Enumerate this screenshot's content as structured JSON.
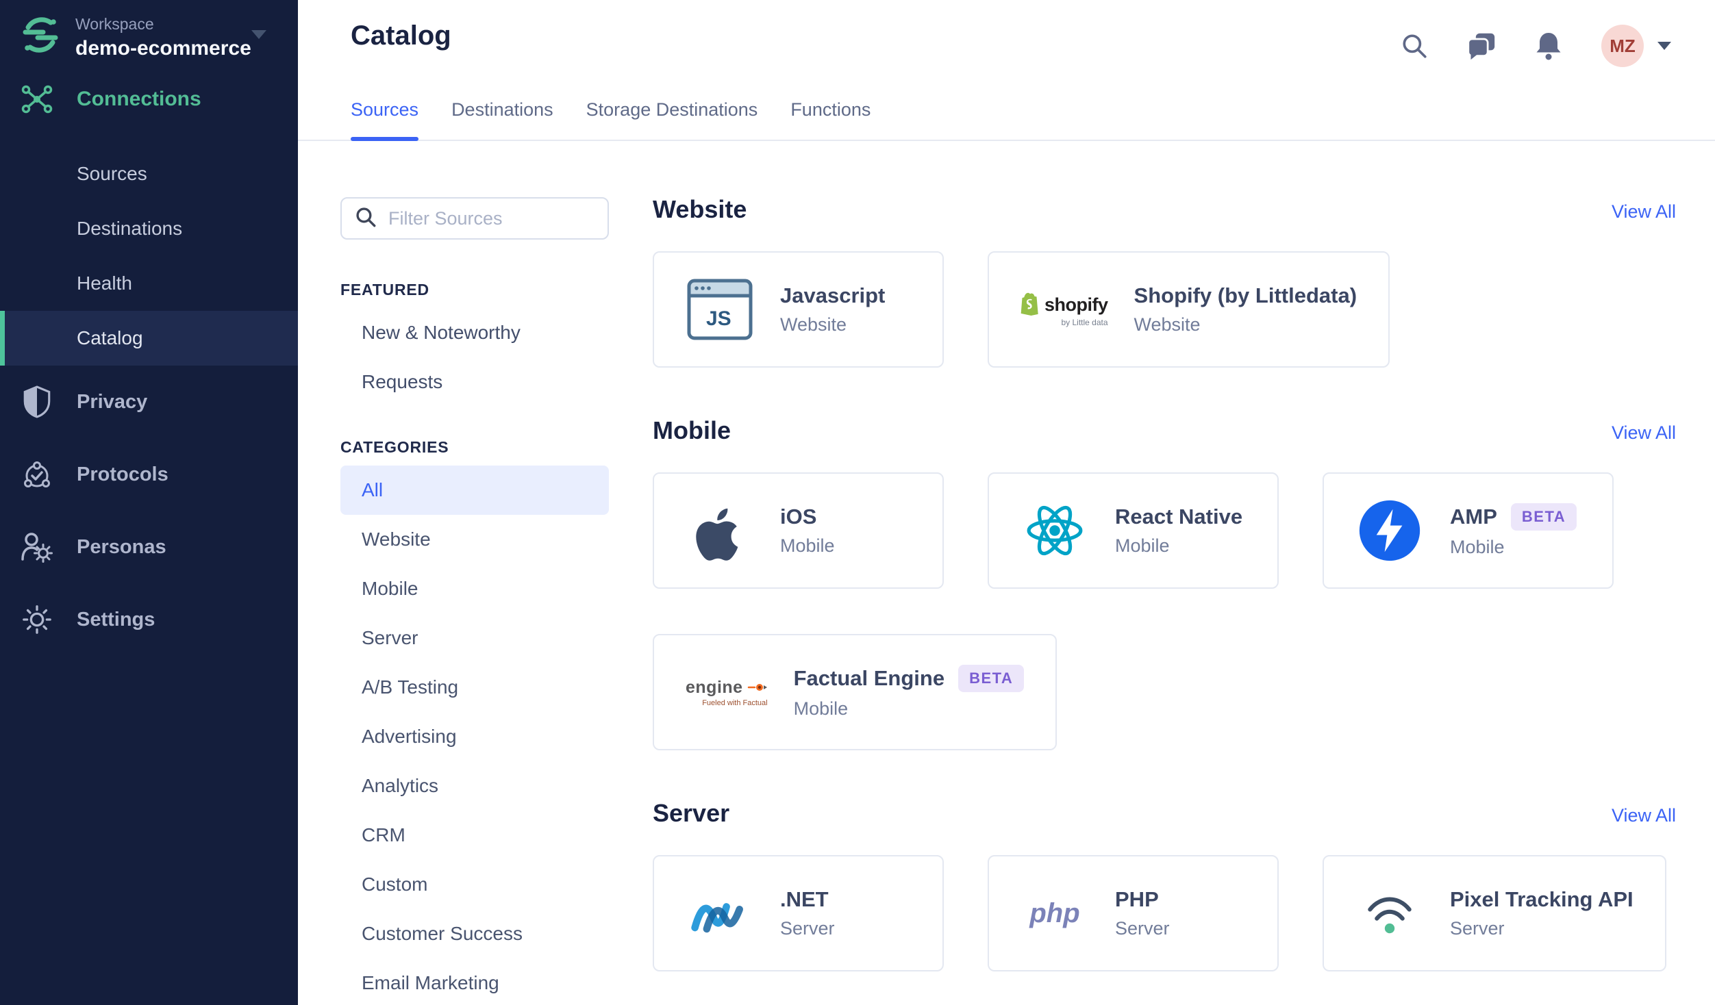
{
  "colors": {
    "brand_green": "#53BD95",
    "accent_blue": "#3B63F5",
    "sidebar_bg": "#141E3C",
    "beta_text": "#7A5ED2",
    "beta_bg": "#ECE6FA",
    "avatar_bg": "#F8D8D4",
    "avatar_text": "#A13E36",
    "react_cyan": "#00A3C7",
    "amp_blue": "#1664EC",
    "shopify_green": "#95BF47"
  },
  "sidebar": {
    "workspace": {
      "label": "Workspace",
      "name": "demo-ecommerce"
    },
    "primary_item": {
      "label": "Connections",
      "icon": "connections"
    },
    "connection_items": [
      {
        "label": "Sources",
        "active": false
      },
      {
        "label": "Destinations",
        "active": false
      },
      {
        "label": "Health",
        "active": false
      },
      {
        "label": "Catalog",
        "active": true
      }
    ],
    "other_items": [
      {
        "label": "Privacy",
        "icon": "shield"
      },
      {
        "label": "Protocols",
        "icon": "protocols"
      },
      {
        "label": "Personas",
        "icon": "personas"
      },
      {
        "label": "Settings",
        "icon": "gear"
      }
    ]
  },
  "header": {
    "title": "Catalog",
    "tabs": [
      {
        "label": "Sources",
        "active": true
      },
      {
        "label": "Destinations",
        "active": false
      },
      {
        "label": "Storage Destinations",
        "active": false
      },
      {
        "label": "Functions",
        "active": false
      }
    ],
    "avatar_initials": "MZ"
  },
  "rail": {
    "filter_placeholder": "Filter Sources",
    "featured_heading": "FEATURED",
    "featured_items": [
      {
        "label": "New & Noteworthy"
      },
      {
        "label": "Requests"
      }
    ],
    "categories_heading": "CATEGORIES",
    "categories": [
      {
        "label": "All",
        "active": true
      },
      {
        "label": "Website",
        "active": false
      },
      {
        "label": "Mobile",
        "active": false
      },
      {
        "label": "Server",
        "active": false
      },
      {
        "label": "A/B Testing",
        "active": false
      },
      {
        "label": "Advertising",
        "active": false
      },
      {
        "label": "Analytics",
        "active": false
      },
      {
        "label": "CRM",
        "active": false
      },
      {
        "label": "Custom",
        "active": false
      },
      {
        "label": "Customer Success",
        "active": false
      },
      {
        "label": "Email Marketing",
        "active": false
      }
    ]
  },
  "catalog_sections": [
    {
      "title": "Website",
      "view_all_label": "View All",
      "cards": [
        {
          "name": "Javascript",
          "category": "Website",
          "icon": "javascript-browser"
        },
        {
          "name": "Shopify (by Littledata)",
          "category": "Website",
          "icon": "shopify",
          "logo_caption": "by Little data"
        }
      ]
    },
    {
      "title": "Mobile",
      "view_all_label": "View All",
      "cards": [
        {
          "name": "iOS",
          "category": "Mobile",
          "icon": "apple"
        },
        {
          "name": "React Native",
          "category": "Mobile",
          "icon": "react"
        },
        {
          "name": "AMP",
          "category": "Mobile",
          "icon": "amp",
          "badge": "BETA"
        },
        {
          "name": "Factual Engine",
          "category": "Mobile",
          "icon": "factual-engine",
          "badge": "BETA",
          "logo_caption": "Fueled with Factual"
        }
      ]
    },
    {
      "title": "Server",
      "view_all_label": "View All",
      "cards": [
        {
          "name": ".NET",
          "category": "Server",
          "icon": "dotnet"
        },
        {
          "name": "PHP",
          "category": "Server",
          "icon": "php"
        },
        {
          "name": "Pixel Tracking API",
          "category": "Server",
          "icon": "pixel-tracking"
        }
      ]
    }
  ]
}
